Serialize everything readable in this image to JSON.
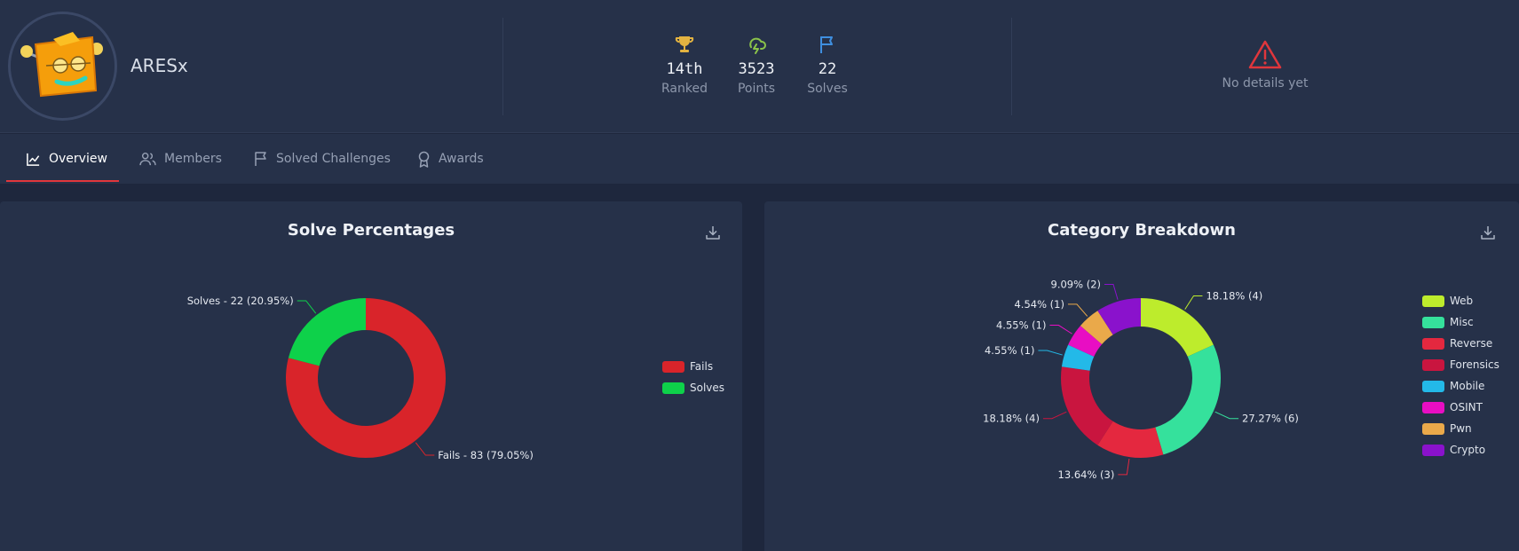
{
  "team": {
    "name": "ARESx"
  },
  "stats": [
    {
      "value": "14th",
      "label": "Ranked",
      "icon": "trophy-icon",
      "color": "#e3b341"
    },
    {
      "value": "3523",
      "label": "Points",
      "icon": "cloud-lightning-icon",
      "color": "#8bc34a"
    },
    {
      "value": "22",
      "label": "Solves",
      "icon": "flag-icon",
      "color": "#3f8fe0"
    }
  ],
  "details": {
    "label": "No details yet",
    "icon": "warning-icon",
    "color": "#e0363c"
  },
  "tabs": [
    {
      "label": "Overview",
      "icon": "line-chart-icon",
      "active": true
    },
    {
      "label": "Members",
      "icon": "users-icon",
      "active": false
    },
    {
      "label": "Solved Challenges",
      "icon": "flag-icon",
      "active": false
    },
    {
      "label": "Awards",
      "icon": "award-icon",
      "active": false
    }
  ],
  "charts": {
    "solve_title": "Solve Percentages",
    "category_title": "Category Breakdown"
  },
  "chart_data": [
    {
      "type": "pie",
      "title": "Solve Percentages",
      "legend_position": "right",
      "categories": [
        "Fails",
        "Solves"
      ],
      "values": [
        83,
        22
      ],
      "colors": [
        "#d9242a",
        "#0ed14a"
      ],
      "labels": [
        "Fails - 83 (79.05%)",
        "Solves - 22 (20.95%)"
      ]
    },
    {
      "type": "pie",
      "title": "Category Breakdown",
      "legend_position": "right",
      "categories": [
        "Web",
        "Misc",
        "Reverse",
        "Forensics",
        "Mobile",
        "OSINT",
        "Pwn",
        "Crypto"
      ],
      "values": [
        4,
        6,
        3,
        4,
        1,
        1,
        1,
        2
      ],
      "colors": [
        "#bdec2c",
        "#35e19c",
        "#e4283f",
        "#c9153f",
        "#23b9e8",
        "#e80ec3",
        "#eaa94a",
        "#8a12cc"
      ],
      "labels": [
        "18.18% (4)",
        "27.27% (6)",
        "13.64% (3)",
        "18.18% (4)",
        "4.55% (1)",
        "4.55% (1)",
        "4.54% (1)",
        "9.09% (2)"
      ]
    }
  ]
}
